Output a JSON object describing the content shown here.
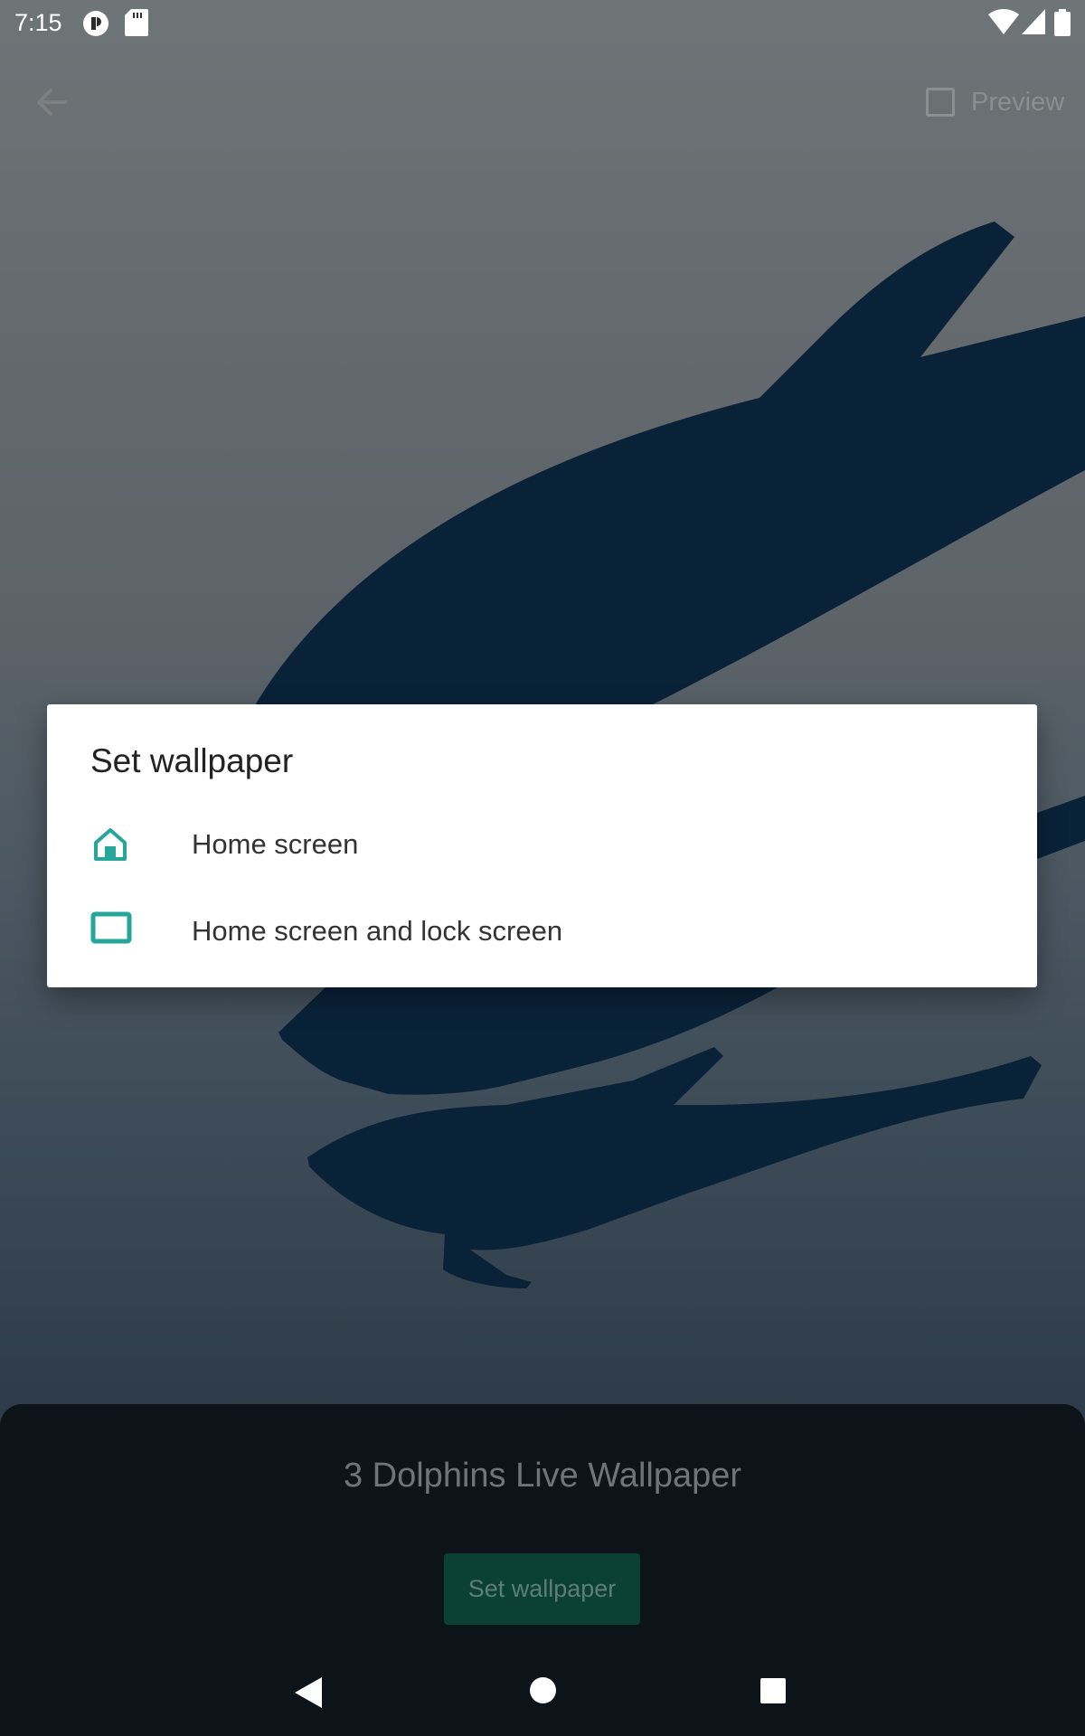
{
  "status_bar": {
    "time": "7:15",
    "icons": [
      "sync-icon",
      "sd-card-icon",
      "wifi-icon",
      "signal-icon",
      "battery-icon"
    ]
  },
  "top_bar": {
    "back_icon": "arrow-back-icon",
    "preview_label": "Preview",
    "preview_checked": false
  },
  "wallpaper": {
    "name": "3 Dolphins Live Wallpaper",
    "set_button_label": "Set wallpaper"
  },
  "dialog": {
    "title": "Set wallpaper",
    "options": [
      {
        "label": "Home screen",
        "icon": "home-icon"
      },
      {
        "label": "Home screen and lock screen",
        "icon": "screen-icon"
      }
    ]
  },
  "navigation": {
    "back": "nav-back-icon",
    "home": "nav-home-icon",
    "recents": "nav-recents-icon"
  },
  "colors": {
    "accent": "#26a69a",
    "sheet_background": "#0c1319",
    "dolphin": "#0a2238"
  }
}
